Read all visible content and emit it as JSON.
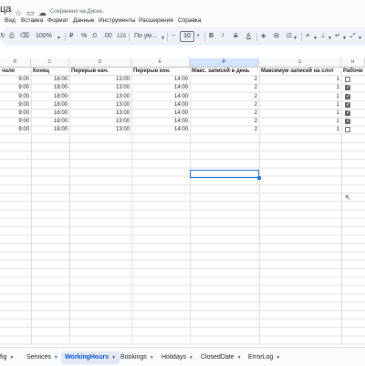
{
  "app": {
    "title_fragment": "ца",
    "saved_status": "Сохранено на Диске."
  },
  "icons": {
    "star": "star-icon",
    "move": "move-to-folder-icon",
    "cloud": "cloud-saved-icon"
  },
  "menu": [
    "Вид",
    "Вставка",
    "Формат",
    "Данные",
    "Инструменты",
    "Расширения",
    "Справка"
  ],
  "toolbar": {
    "zoom": "100%",
    "percent": "%",
    "decrease_decimals": ".0",
    "increase_decimals": ".00",
    "number_format": "123",
    "font": "По ум...",
    "font_size": "10",
    "minus": "−",
    "plus": "+",
    "bold": "B",
    "italic": "I",
    "strike": "S",
    "text_color": "A"
  },
  "sheet": {
    "column_letters": [
      "B",
      "C",
      "D",
      "E",
      "F",
      "G",
      "H"
    ],
    "selected_column": "F",
    "headers": [
      "чало",
      "Конец",
      "Перерыв нач.",
      "Перерыв кон.",
      "Макс. записей в день",
      "Максимум записей на слот",
      "Рабочи"
    ],
    "rows": [
      {
        "start": "9:00",
        "end": "18:00",
        "break_start": "13:00",
        "break_end": "14:00",
        "max_day": "2",
        "max_slot": "1",
        "working": false
      },
      {
        "start": "9:00",
        "end": "18:00",
        "break_start": "13:00",
        "break_end": "14:00",
        "max_day": "2",
        "max_slot": "1",
        "working": true
      },
      {
        "start": "9:00",
        "end": "18:00",
        "break_start": "13:00",
        "break_end": "14:00",
        "max_day": "2",
        "max_slot": "1",
        "working": true
      },
      {
        "start": "9:00",
        "end": "18:00",
        "break_start": "13:00",
        "break_end": "14:00",
        "max_day": "2",
        "max_slot": "1",
        "working": true
      },
      {
        "start": "9:00",
        "end": "18:00",
        "break_start": "13:00",
        "break_end": "14:00",
        "max_day": "2",
        "max_slot": "1",
        "working": true
      },
      {
        "start": "9:00",
        "end": "18:00",
        "break_start": "13:00",
        "break_end": "14:00",
        "max_day": "2",
        "max_slot": "1",
        "working": true
      },
      {
        "start": "9:00",
        "end": "18:00",
        "break_start": "13:00",
        "break_end": "14:00",
        "max_day": "2",
        "max_slot": "1",
        "working": false
      }
    ]
  },
  "tabs": [
    {
      "label": "fig",
      "active": false
    },
    {
      "label": "Services",
      "active": false
    },
    {
      "label": "WorkingHours",
      "active": true
    },
    {
      "label": "Bookings",
      "active": false
    },
    {
      "label": "Holidays",
      "active": false
    },
    {
      "label": "ClosedDate",
      "active": false
    },
    {
      "label": "ErrorLog",
      "active": false
    }
  ]
}
